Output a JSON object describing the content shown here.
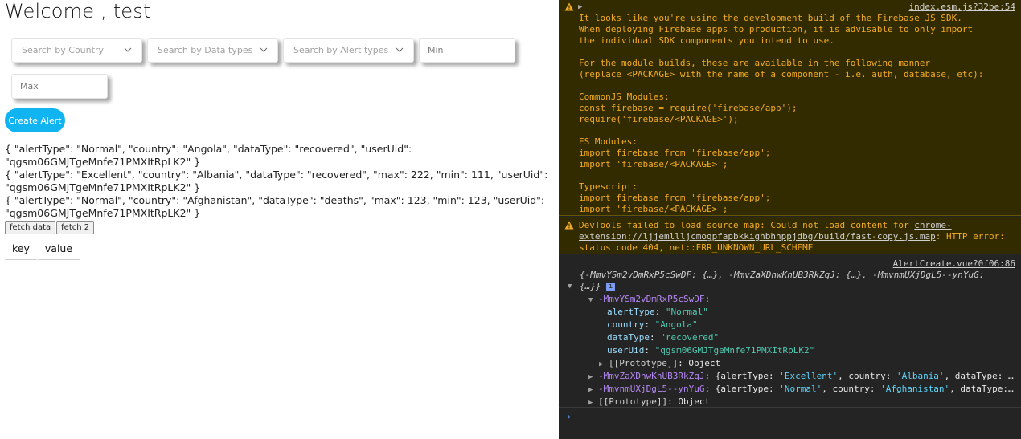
{
  "app": {
    "welcome_prefix": "Welcome ,",
    "user_name": "test",
    "filters": {
      "country_placeholder": "Search by Country",
      "data_types_placeholder": "Search by Data types",
      "alert_types_placeholder": "Search by Alert types",
      "min_placeholder": "Min",
      "max_placeholder": "Max"
    },
    "create_alert_label": "Create Alert",
    "records": [
      "{ \"alertType\": \"Normal\", \"country\": \"Angola\", \"dataType\": \"recovered\", \"userUid\": \"qgsm06GMJTgeMnfe71PMXItRpLK2\" }",
      "{ \"alertType\": \"Excellent\", \"country\": \"Albania\", \"dataType\": \"recovered\", \"max\": 222, \"min\": 111, \"userUid\": \"qgsm06GMJTgeMnfe71PMXItRpLK2\" }",
      "{ \"alertType\": \"Normal\", \"country\": \"Afghanistan\", \"dataType\": \"deaths\", \"max\": 123, \"min\": 123, \"userUid\": \"qgsm06GMJTgeMnfe71PMXItRpLK2\" }"
    ],
    "fetch_data_label": "fetch data",
    "fetch_2_label": "fetch 2",
    "table_headers": [
      "key",
      "value"
    ]
  },
  "console": {
    "warning1": {
      "source": "index.esm.js?32be:54",
      "text": "It looks like you're using the development build of the Firebase JS SDK.\nWhen deploying Firebase apps to production, it is advisable to only import\nthe individual SDK components you intend to use.\n\nFor the module builds, these are available in the following manner\n(replace <PACKAGE> with the name of a component - i.e. auth, database, etc):\n\nCommonJS Modules:\nconst firebase = require('firebase/app');\nrequire('firebase/<PACKAGE>');\n\nES Modules:\nimport firebase from 'firebase/app';\nimport 'firebase/<PACKAGE>';\n\nTypescript:\nimport firebase from 'firebase/app';\nimport 'firebase/<PACKAGE>';"
    },
    "warning2": {
      "prefix": "DevTools failed to load source map: Could not load content for ",
      "link": "chrome-extension://ljjemllljcmogpfapbkkighbhhppjdbg/build/fast-copy.js.map",
      "suffix": ": HTTP error: status code 404, net::ERR_UNKNOWN_URL_SCHEME"
    },
    "log": {
      "source": "AlertCreate.vue?0f06:86",
      "summary_line1": "{-MmvYSm2vDmRxP5cSwDF: {…}, -MmvZaXDnwKnUB3RkZqJ: {…}, -MmvnmUXjDgL5--ynYuG:",
      "summary_line2": "{…}}",
      "info_badge": "i",
      "entry1_key": "-MmvYSm2vDmRxP5cSwDF",
      "fields": [
        {
          "key": "alertType",
          "value": "\"Normal\""
        },
        {
          "key": "country",
          "value": "\"Angola\""
        },
        {
          "key": "dataType",
          "value": "\"recovered\""
        },
        {
          "key": "userUid",
          "value": "\"qgsm06GMJTgeMnfe71PMXItRpLK2\""
        }
      ],
      "proto_key": "[[Prototype]]",
      "proto_value": "Object",
      "entry2_key": "-MmvZaXDnwKnUB3RkZqJ",
      "entry2_a": "{alertType: ",
      "entry2_b": "'Excellent'",
      "entry2_c": ", country: ",
      "entry2_d": "'Albania'",
      "entry2_e": ", dataType: …",
      "entry3_key": "-MmvnmUXjDgL5--ynYuG",
      "entry3_a": "{alertType: ",
      "entry3_b": "'Normal'",
      "entry3_c": ", country: ",
      "entry3_d": "'Afghanistan'",
      "entry3_e": ", dataType:…",
      "prompt": "›"
    }
  }
}
